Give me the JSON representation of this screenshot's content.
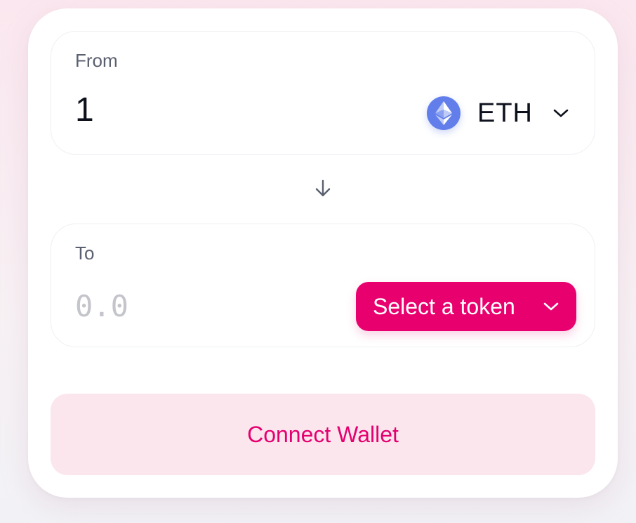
{
  "swap": {
    "from": {
      "label": "From",
      "amount": "1",
      "token_symbol": "ETH",
      "token_icon": "ethereum-icon"
    },
    "switch_icon": "arrow-down-icon",
    "to": {
      "label": "To",
      "amount_placeholder": "0.0",
      "select_token_label": "Select a token"
    },
    "connect_wallet_label": "Connect Wallet"
  },
  "colors": {
    "accent": "#e8006f",
    "connect_bg": "#fce6ee",
    "eth_blue": "#627eea",
    "text_primary": "#0d111c",
    "text_secondary": "#5b6070",
    "placeholder": "#c3c5cb"
  }
}
